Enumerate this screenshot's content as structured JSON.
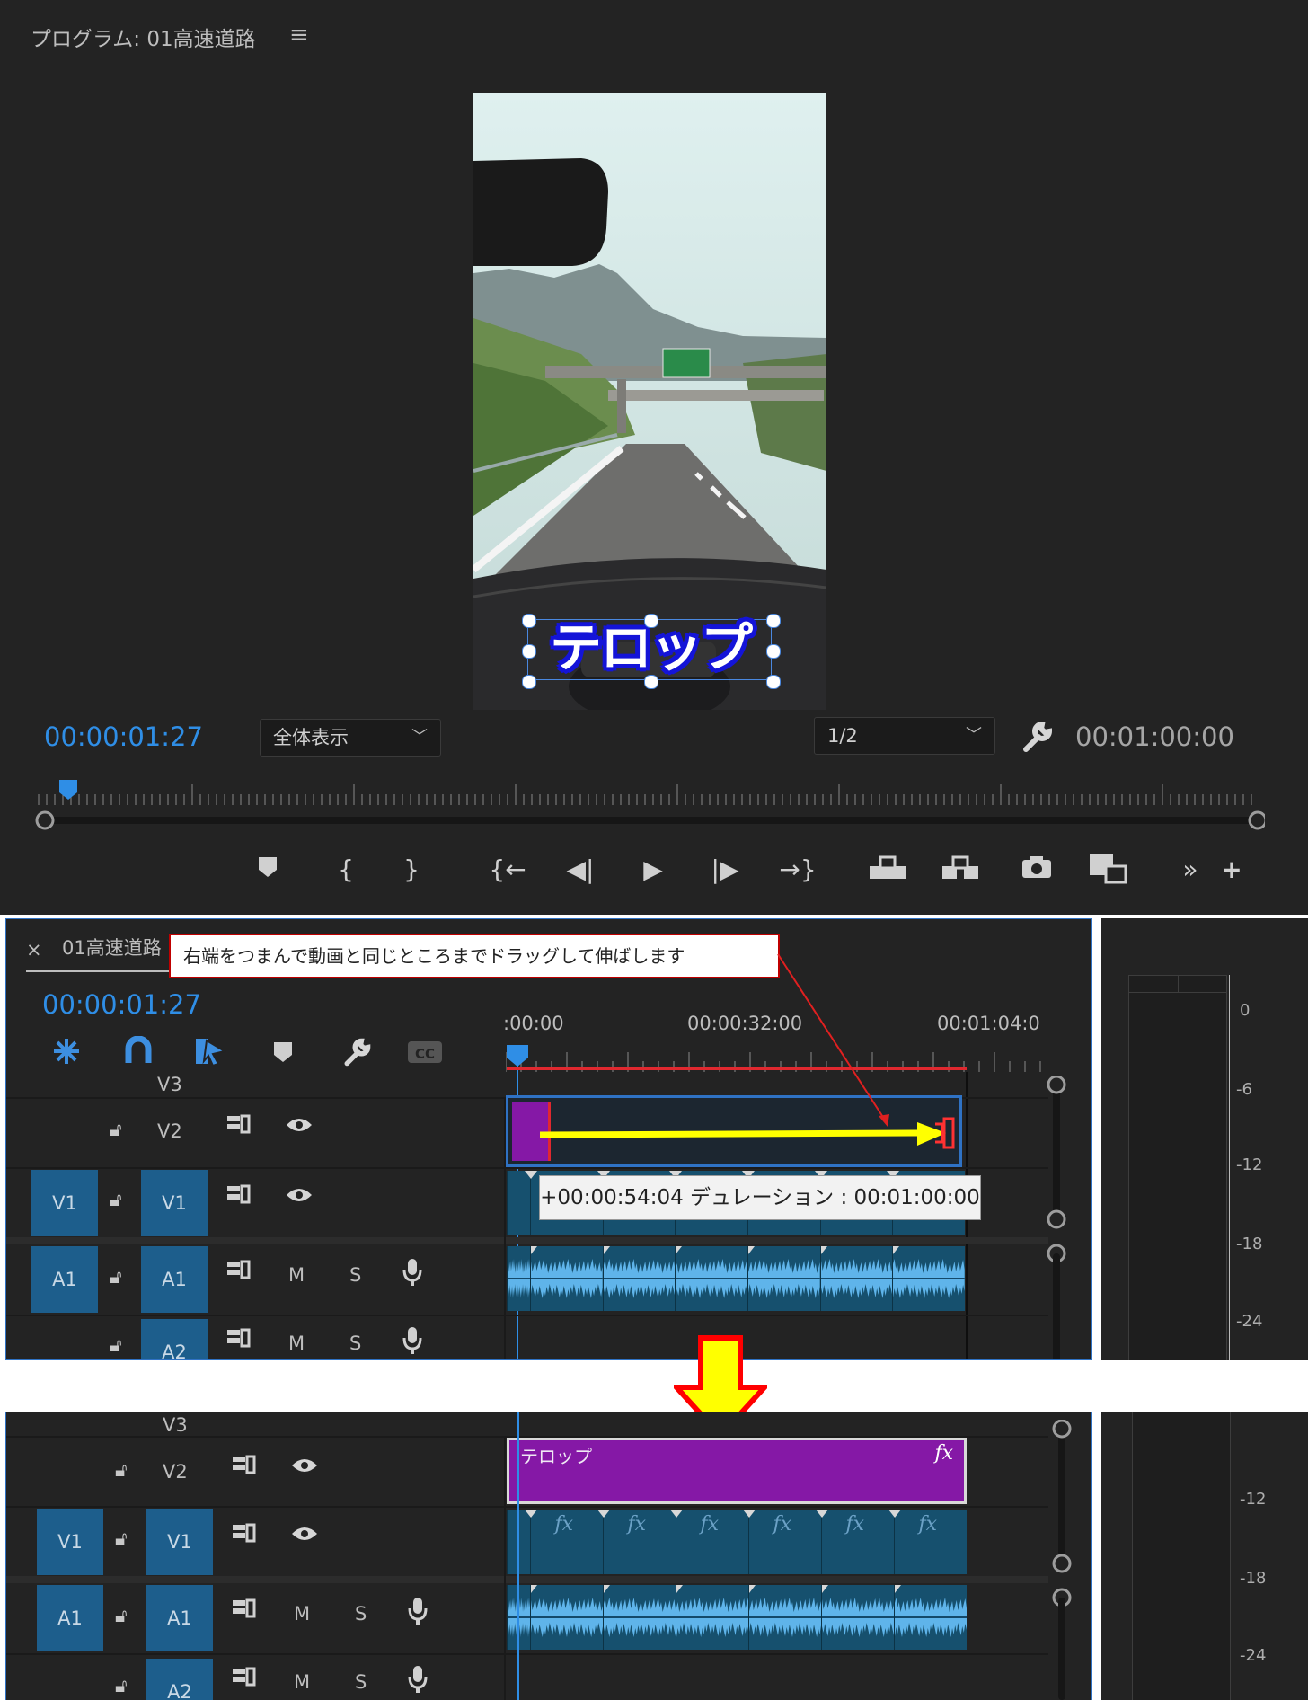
{
  "program": {
    "title": "プログラム: 01高速道路",
    "menu_icon": "hamburger-menu-icon",
    "timecode_current": "00:00:01:27",
    "zoom_label": "全体表示",
    "resolution_label": "1/2",
    "timecode_duration": "00:01:00:00",
    "telop_text": "テロップ",
    "controls": [
      "marker-icon",
      "mark-in-icon",
      "mark-out-icon",
      "go-to-in-icon",
      "step-back-icon",
      "play-icon",
      "step-forward-icon",
      "go-to-out-icon",
      "lift-icon",
      "extract-icon",
      "export-frame-icon",
      "button-editor-icon",
      "more-icon",
      "add-icon"
    ]
  },
  "timeline": {
    "close_label": "×",
    "sequence_name": "01高速道路",
    "timecode": "00:00:01:27",
    "ruler_labels": [
      ":00:00",
      "00:00:32:00",
      "00:01:04:0"
    ],
    "tracks": {
      "v3": "V3",
      "v2": "V2",
      "v1_source": "V1",
      "v1": "V1",
      "a1_source": "A1",
      "a1": "A1",
      "a2": "A2",
      "mute": "M",
      "solo": "S"
    },
    "tooltip": "+00:00:54:04 デュレーション : 00:01:00:00",
    "clip_fx": "fx"
  },
  "callout": {
    "text": "右端をつまんで動画と同じところまでドラッグして伸ばします"
  },
  "timeline_after": {
    "telop_clip_label": "テロップ",
    "telop_fx": "fx"
  },
  "meters": {
    "labels": [
      "0",
      "-6",
      "-12",
      "-18",
      "-24"
    ],
    "labels_after": [
      "-12",
      "-18",
      "-24"
    ]
  },
  "colors": {
    "accent_blue": "#2f8ee6",
    "track_blue": "#1d5e8c",
    "telop_purple": "#8518a6",
    "arrow_yellow": "#ffff00",
    "arrow_red": "#ff0000",
    "playhead_red": "#e0282f"
  }
}
